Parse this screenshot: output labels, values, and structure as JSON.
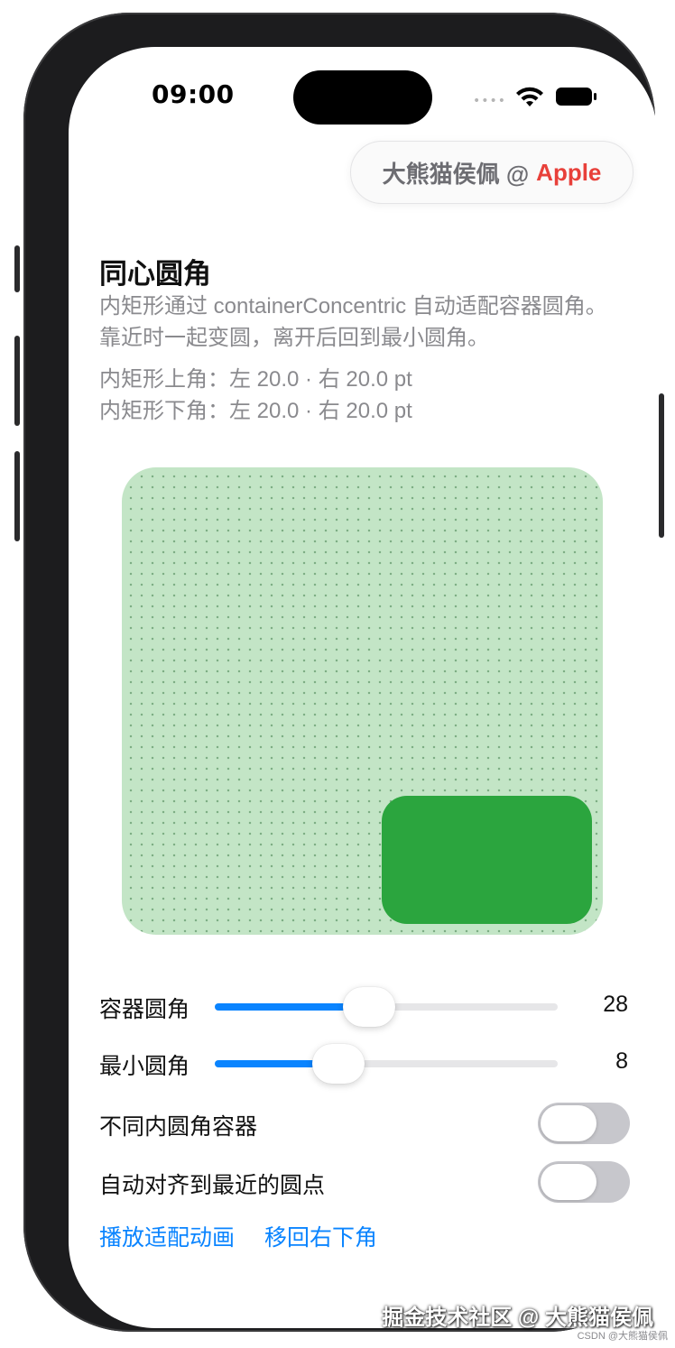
{
  "status_bar": {
    "time": "09:00",
    "dots": "••••",
    "wifi_icon": "wifi-icon",
    "battery_icon": "battery-icon"
  },
  "author_pill": {
    "name": "大熊猫侯佩 @",
    "brand": "Apple",
    "brand_color": "#e8403a"
  },
  "header": {
    "title": "同心圆角",
    "description": "内矩形通过 containerConcentric 自动适配容器圆角。靠近时一起变圆，离开后回到最小圆角。",
    "top_corners": "内矩形上角：左 20.0 · 右 20.0 pt",
    "bottom_corners": "内矩形下角：左 20.0 · 右 20.0 pt"
  },
  "preview": {
    "container_color": "#c3e5c6",
    "inner_color": "#2ba53e"
  },
  "controls": {
    "container_radius": {
      "label": "容器圆角",
      "value": "28",
      "fraction": 0.45
    },
    "min_radius": {
      "label": "最小圆角",
      "value": "8",
      "fraction": 0.36
    },
    "different_inner_toggle": {
      "label": "不同内圆角容器",
      "on": false
    },
    "snap_toggle": {
      "label": "自动对齐到最近的圆点",
      "on": false
    }
  },
  "actions": {
    "play": "播放适配动画",
    "move_back": "移回右下角"
  },
  "accent_color": "#0a84ff",
  "watermark": {
    "main": "掘金技术社区 @ 大熊猫侯佩",
    "small": "CSDN @大熊猫侯佩"
  }
}
